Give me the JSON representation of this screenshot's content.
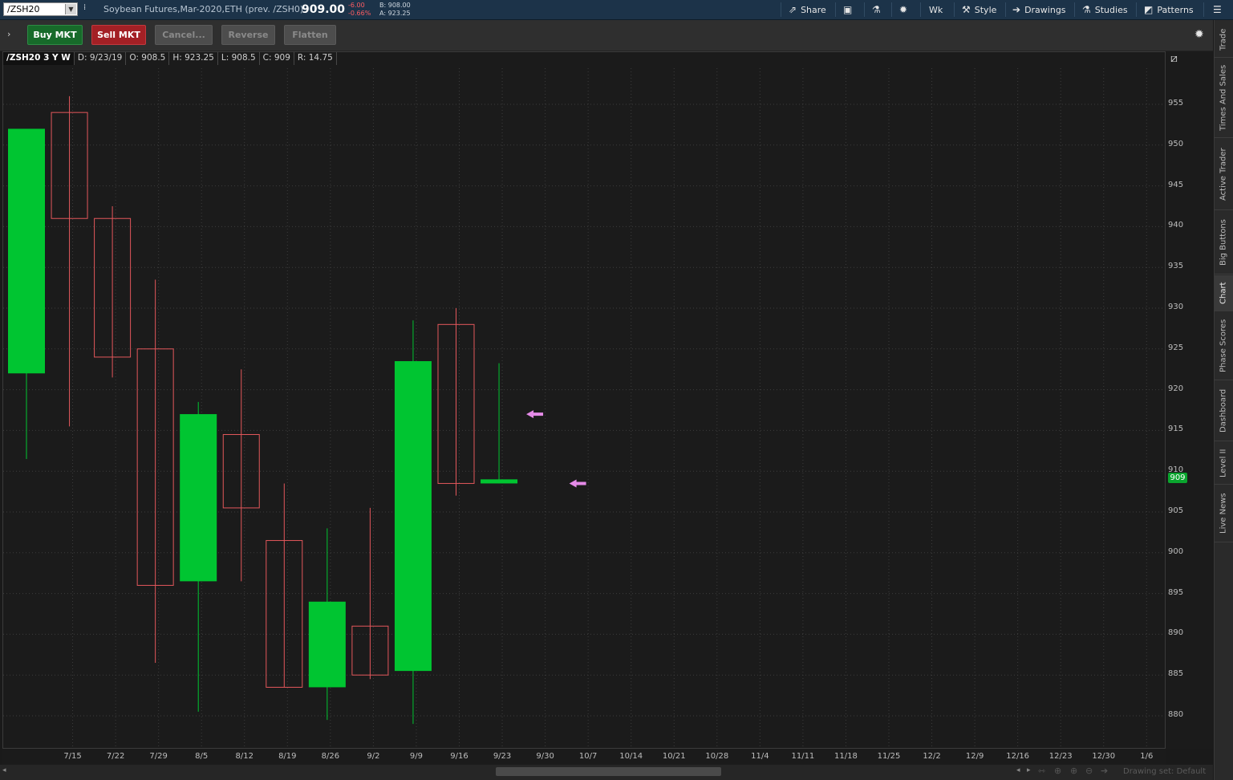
{
  "header": {
    "symbol": "/ZSH20",
    "description": "Soybean Futures,Mar-2020,ETH (prev. /ZSH0)",
    "last_price": "909.00",
    "change": "-6.00",
    "change_pct": "-0.66%",
    "bid": "B: 908.00",
    "ask": "A: 923.25",
    "buttons": {
      "share": "Share",
      "period": "Wk",
      "style": "Style",
      "drawings": "Drawings",
      "studies": "Studies",
      "patterns": "Patterns"
    }
  },
  "toolbar": {
    "buy": "Buy MKT",
    "sell": "Sell MKT",
    "cancel": "Cancel...",
    "reverse": "Reverse",
    "flatten": "Flatten"
  },
  "chart_info": {
    "title": "/ZSH20 3 Y W",
    "date": "D: 9/23/19",
    "open": "O: 908.5",
    "high": "H: 923.25",
    "low": "L: 908.5",
    "close": "C: 909",
    "range": "R: 14.75"
  },
  "sidebar_tabs": [
    "Trade",
    "Times And Sales",
    "Active Trader",
    "Big Buttons",
    "Chart",
    "Phase Scores",
    "Dashboard",
    "Level II",
    "Live News"
  ],
  "current_price_label": "909",
  "status": {
    "drawing_set": "Drawing set: Default"
  },
  "colors": {
    "up": "#00c531",
    "down": "#e3575b",
    "accent": "#1c3349",
    "arrow": "#e58be8"
  },
  "chart_data": {
    "type": "candlestick",
    "title": "/ZSH20 3 Y W",
    "xlabel": "",
    "ylabel": "",
    "ylim": [
      878,
      960
    ],
    "price_ticks": [
      880,
      885,
      890,
      895,
      900,
      905,
      910,
      915,
      920,
      925,
      930,
      935,
      940,
      945,
      950,
      955
    ],
    "date_ticks": [
      "7/15",
      "7/22",
      "7/29",
      "8/5",
      "8/12",
      "8/19",
      "8/26",
      "9/2",
      "9/9",
      "9/16",
      "9/23",
      "9/30",
      "10/7",
      "10/14",
      "10/21",
      "10/28",
      "11/4",
      "11/11",
      "11/18",
      "11/25",
      "12/2",
      "12/9",
      "12/16",
      "12/23",
      "12/30",
      "1/6"
    ],
    "grid": true,
    "candles": [
      {
        "date": "7/8",
        "open": 922,
        "high": 952,
        "low": 911.5,
        "close": 952,
        "up": true
      },
      {
        "date": "7/15",
        "open": 941,
        "high": 956,
        "low": 915.5,
        "close": 954,
        "up": false
      },
      {
        "date": "7/22",
        "open": 924,
        "high": 942.5,
        "low": 921.5,
        "close": 941,
        "up": false
      },
      {
        "date": "7/29",
        "open": 896,
        "high": 933.5,
        "low": 886.5,
        "close": 925,
        "up": false
      },
      {
        "date": "8/5",
        "open": 896.5,
        "high": 918.5,
        "low": 880.5,
        "close": 917,
        "up": true
      },
      {
        "date": "8/12",
        "open": 905.5,
        "high": 922.5,
        "low": 896.5,
        "close": 914.5,
        "up": false
      },
      {
        "date": "8/19",
        "open": 883.5,
        "high": 908.5,
        "low": 883.5,
        "close": 901.5,
        "up": false
      },
      {
        "date": "8/26",
        "open": 883.5,
        "high": 903,
        "low": 879.5,
        "close": 894,
        "up": true
      },
      {
        "date": "9/2",
        "open": 885,
        "high": 905.5,
        "low": 884.5,
        "close": 891,
        "up": false
      },
      {
        "date": "9/9",
        "open": 885.5,
        "high": 928.5,
        "low": 879,
        "close": 923.5,
        "up": true
      },
      {
        "date": "9/16",
        "open": 908.5,
        "high": 930,
        "low": 907,
        "close": 928,
        "up": false
      },
      {
        "date": "9/23",
        "open": 908.5,
        "high": 923.25,
        "low": 908.5,
        "close": 909,
        "up": true
      }
    ],
    "annotations": [
      {
        "type": "arrow",
        "direction": "left",
        "price": 917,
        "after_date": "9/23"
      },
      {
        "type": "arrow",
        "direction": "left",
        "price": 908.5,
        "after_date": "9/30"
      }
    ]
  }
}
